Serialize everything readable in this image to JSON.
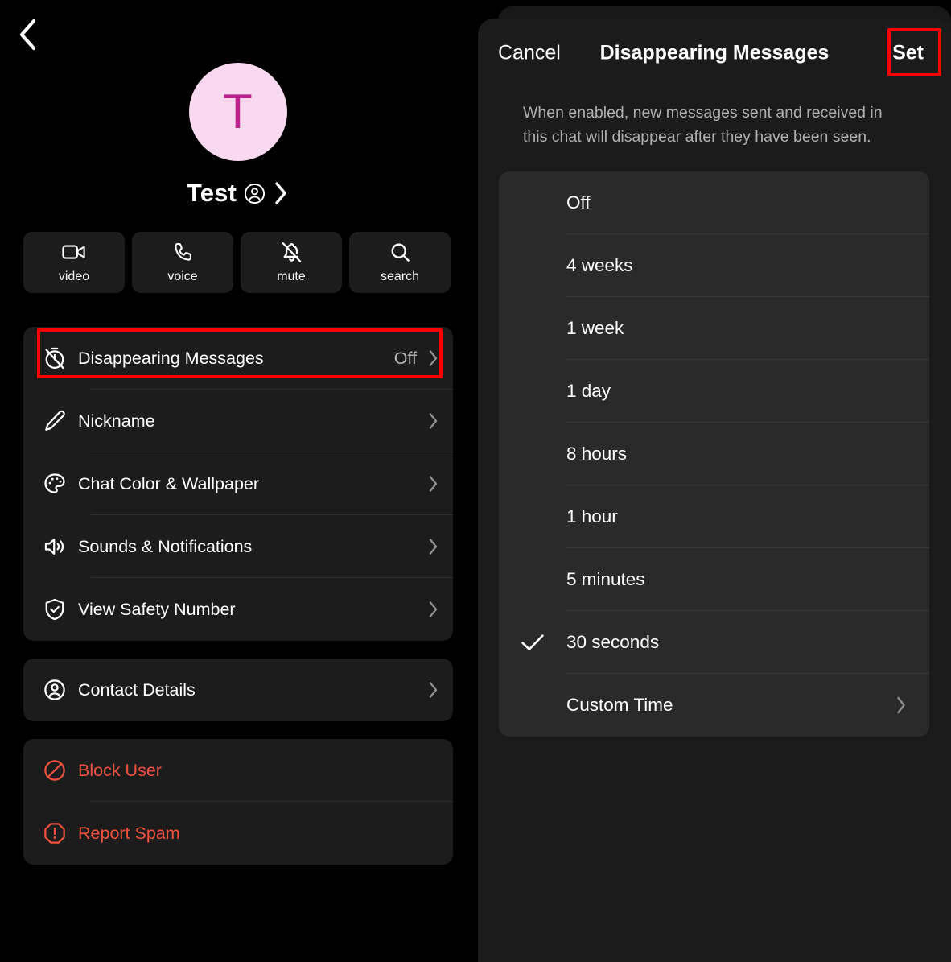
{
  "left_panel": {
    "back_icon": "chevron-left-icon",
    "profile": {
      "avatar_initial": "T",
      "avatar_bg_color": "#F8D9EF",
      "avatar_text_color": "#BF1F8A",
      "display_name": "Test",
      "badge_icon": "person-circle-icon",
      "chevron_icon": "chevron-right-icon"
    },
    "action_buttons": [
      {
        "label": "video",
        "icon": "video-camera-icon"
      },
      {
        "label": "voice",
        "icon": "phone-icon"
      },
      {
        "label": "mute",
        "icon": "bell-slash-icon"
      },
      {
        "label": "search",
        "icon": "magnifier-icon"
      }
    ],
    "settings_rows": [
      {
        "label": "Disappearing Messages",
        "value": "Off",
        "icon": "timer-off-icon",
        "chevron": true,
        "highlighted": true
      },
      {
        "label": "Nickname",
        "value": "",
        "icon": "pencil-icon",
        "chevron": true,
        "highlighted": false
      },
      {
        "label": "Chat Color & Wallpaper",
        "value": "",
        "icon": "palette-icon",
        "chevron": true,
        "highlighted": false
      },
      {
        "label": "Sounds & Notifications",
        "value": "",
        "icon": "speaker-icon",
        "chevron": true,
        "highlighted": false
      },
      {
        "label": "View Safety Number",
        "value": "",
        "icon": "shield-check-icon",
        "chevron": true,
        "highlighted": false
      }
    ],
    "contact_rows": [
      {
        "label": "Contact Details",
        "icon": "person-circle-icon",
        "chevron": true
      }
    ],
    "danger_rows": [
      {
        "label": "Block User",
        "icon": "block-icon"
      },
      {
        "label": "Report Spam",
        "icon": "alert-octagon-icon"
      }
    ],
    "danger_color": "#F0513F",
    "highlight_color": "#FE0000"
  },
  "sheet": {
    "cancel_label": "Cancel",
    "title": "Disappearing Messages",
    "set_label": "Set",
    "description": "When enabled, new messages sent and received in this chat will disappear after they have been seen.",
    "selected_option": "30 seconds",
    "check_icon": "checkmark-icon",
    "options": [
      {
        "label": "Off",
        "selected": false,
        "chevron": false
      },
      {
        "label": "4 weeks",
        "selected": false,
        "chevron": false
      },
      {
        "label": "1 week",
        "selected": false,
        "chevron": false
      },
      {
        "label": "1 day",
        "selected": false,
        "chevron": false
      },
      {
        "label": "8 hours",
        "selected": false,
        "chevron": false
      },
      {
        "label": "1 hour",
        "selected": false,
        "chevron": false
      },
      {
        "label": "5 minutes",
        "selected": false,
        "chevron": false
      },
      {
        "label": "30 seconds",
        "selected": true,
        "chevron": false
      },
      {
        "label": "Custom Time",
        "selected": false,
        "chevron": true
      }
    ]
  }
}
